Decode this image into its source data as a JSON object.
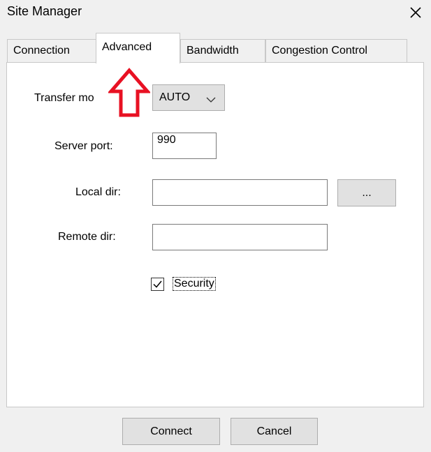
{
  "window": {
    "title": "Site Manager",
    "close_icon": "close-icon"
  },
  "tabs": [
    {
      "label": "Connection",
      "active": false
    },
    {
      "label": "Advanced",
      "active": true
    },
    {
      "label": "Bandwidth",
      "active": false
    },
    {
      "label": "Congestion Control",
      "active": false
    }
  ],
  "form": {
    "transfer_mode": {
      "label": "Transfer mo",
      "value": "AUTO"
    },
    "server_port": {
      "label": "Server port:",
      "value": "990"
    },
    "local_dir": {
      "label": "Local dir:",
      "value": "",
      "browse_label": "..."
    },
    "remote_dir": {
      "label": "Remote dir:",
      "value": ""
    },
    "security": {
      "label": "Security",
      "checked": true
    }
  },
  "footer": {
    "connect_label": "Connect",
    "cancel_label": "Cancel"
  },
  "annotation": {
    "arrow_color": "#e81123",
    "icon": "up-arrow-icon"
  },
  "colors": {
    "window_bg": "#f0f0f0",
    "panel_bg": "#ffffff",
    "button_bg": "#e1e1e1"
  }
}
